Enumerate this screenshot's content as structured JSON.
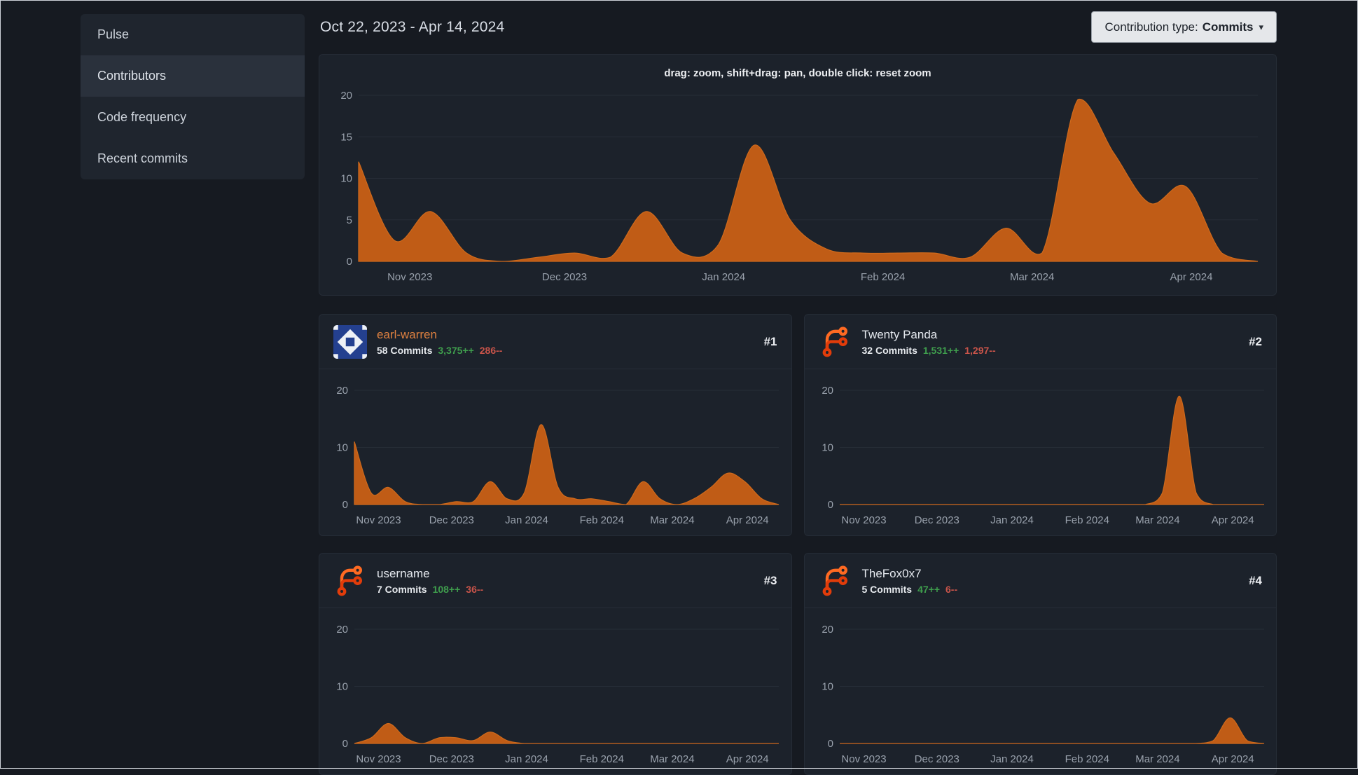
{
  "header": {
    "date_range": "Oct 22, 2023 - Apr 14, 2024",
    "contribution_type_label": "Contribution type:",
    "contribution_type_value": "Commits",
    "caret": "▾"
  },
  "sidebar": {
    "items": [
      {
        "label": "Pulse",
        "active": false
      },
      {
        "label": "Contributors",
        "active": true
      },
      {
        "label": "Code frequency",
        "active": false
      },
      {
        "label": "Recent commits",
        "active": false
      }
    ]
  },
  "colors": {
    "area_fill": "#c05c16",
    "area_line": "#cf6a1c",
    "additions": "#3f9e4d",
    "deletions": "#c9544a",
    "highlight_name": "#dd8040",
    "default_name": "#e4e8ee"
  },
  "main_chart": {
    "hint": "drag: zoom, shift+drag: pan, double click: reset zoom",
    "type": "area",
    "ymax": 20,
    "yticks": [
      0,
      5,
      10,
      15,
      20
    ],
    "xlabels": [
      "Nov 2023",
      "Dec 2023",
      "Jan 2024",
      "Feb 2024",
      "Mar 2024",
      "Apr 2024"
    ],
    "xpositions": [
      0.057,
      0.229,
      0.406,
      0.583,
      0.749,
      0.926
    ],
    "values": [
      12,
      2.5,
      6,
      1,
      0,
      0.5,
      1,
      0.5,
      6,
      1,
      2,
      14,
      5,
      1.5,
      1,
      1,
      1,
      0.5,
      4,
      1,
      19.5,
      13,
      7,
      9,
      1,
      0
    ]
  },
  "contributors": [
    {
      "rank": "#1",
      "name": "earl-warren",
      "name_color": "#dd8040",
      "commits": "58 Commits",
      "additions": "3,375++",
      "deletions": "286--",
      "avatar_icon": "identicon-avatar",
      "chart": {
        "type": "area",
        "ymax": 20,
        "yticks": [
          0,
          10,
          20
        ],
        "xlabels": [
          "Nov 2023",
          "Dec 2023",
          "Jan 2024",
          "Feb 2024",
          "Mar 2024",
          "Apr 2024"
        ],
        "xpositions": [
          0.057,
          0.229,
          0.406,
          0.583,
          0.749,
          0.926
        ],
        "values": [
          11,
          2,
          3,
          0.5,
          0,
          0,
          0.5,
          0.5,
          4,
          1,
          2,
          14,
          3,
          1,
          1,
          0.5,
          0,
          4,
          1,
          0,
          1,
          3,
          5.5,
          4,
          1,
          0
        ]
      }
    },
    {
      "rank": "#2",
      "name": "Twenty Panda",
      "name_color": "#e4e8ee",
      "commits": "32 Commits",
      "additions": "1,531++",
      "deletions": "1,297--",
      "avatar_icon": "forgejo-logo",
      "chart": {
        "type": "area",
        "ymax": 20,
        "yticks": [
          0,
          10,
          20
        ],
        "xlabels": [
          "Nov 2023",
          "Dec 2023",
          "Jan 2024",
          "Feb 2024",
          "Mar 2024",
          "Apr 2024"
        ],
        "xpositions": [
          0.057,
          0.229,
          0.406,
          0.583,
          0.749,
          0.926
        ],
        "values": [
          0,
          0,
          0,
          0,
          0,
          0,
          0,
          0,
          0,
          0,
          0,
          0,
          0,
          0,
          0,
          0,
          0,
          0,
          0,
          2,
          19,
          2,
          0,
          0,
          0,
          0
        ]
      }
    },
    {
      "rank": "#3",
      "name": "username",
      "name_color": "#e4e8ee",
      "commits": "7 Commits",
      "additions": "108++",
      "deletions": "36--",
      "avatar_icon": "forgejo-logo",
      "chart": {
        "type": "area",
        "ymax": 20,
        "yticks": [
          0,
          10,
          20
        ],
        "xlabels": [
          "Nov 2023",
          "Dec 2023",
          "Jan 2024",
          "Feb 2024",
          "Mar 2024",
          "Apr 2024"
        ],
        "xpositions": [
          0.057,
          0.229,
          0.406,
          0.583,
          0.749,
          0.926
        ],
        "values": [
          0,
          1,
          3.5,
          1,
          0,
          1,
          1,
          0.5,
          2,
          0.5,
          0,
          0,
          0,
          0,
          0,
          0,
          0,
          0,
          0,
          0,
          0,
          0,
          0,
          0,
          0,
          0
        ]
      }
    },
    {
      "rank": "#4",
      "name": "TheFox0x7",
      "name_color": "#e4e8ee",
      "commits": "5 Commits",
      "additions": "47++",
      "deletions": "6--",
      "avatar_icon": "forgejo-logo",
      "chart": {
        "type": "area",
        "ymax": 20,
        "yticks": [
          0,
          10,
          20
        ],
        "xlabels": [
          "Nov 2023",
          "Dec 2023",
          "Jan 2024",
          "Feb 2024",
          "Mar 2024",
          "Apr 2024"
        ],
        "xpositions": [
          0.057,
          0.229,
          0.406,
          0.583,
          0.749,
          0.926
        ],
        "values": [
          0,
          0,
          0,
          0,
          0,
          0,
          0,
          0,
          0,
          0,
          0,
          0,
          0,
          0,
          0,
          0,
          0,
          0,
          0,
          0,
          0,
          0,
          0.5,
          4.5,
          0.5,
          0
        ]
      }
    }
  ]
}
